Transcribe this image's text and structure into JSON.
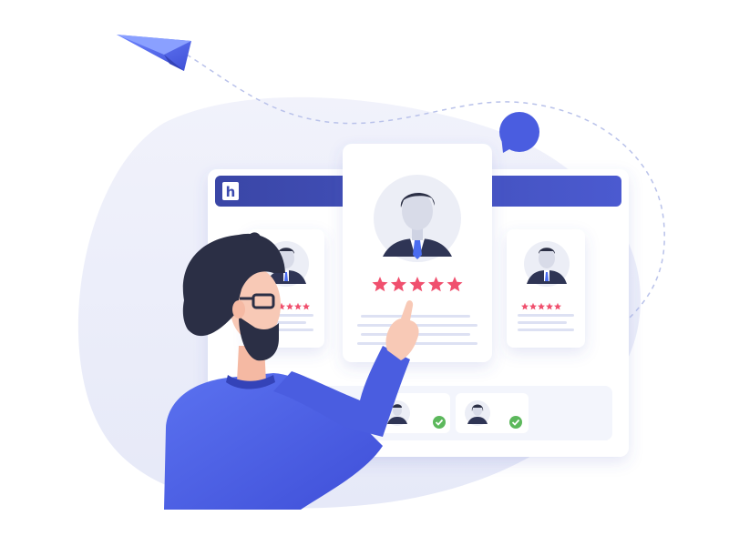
{
  "brand": {
    "logo_letter": "h"
  },
  "colors": {
    "accent": "#4a5de0",
    "accent_light": "#6f86ff",
    "header_bar": "#3d4bb0",
    "star": "#f0506e",
    "check": "#5cb85c",
    "blob": "#eef0fb",
    "hair": "#2b2f45",
    "skin": "#f8c9b6",
    "line_placeholder": "#dde1f3"
  },
  "featured_candidate": {
    "rating": 5,
    "max_rating": 5
  },
  "side_candidates": [
    {
      "rating": 5,
      "max_rating": 5
    },
    {
      "rating": 5,
      "max_rating": 5
    }
  ],
  "shortlist": [
    {
      "approved": true
    },
    {
      "approved": true
    }
  ]
}
